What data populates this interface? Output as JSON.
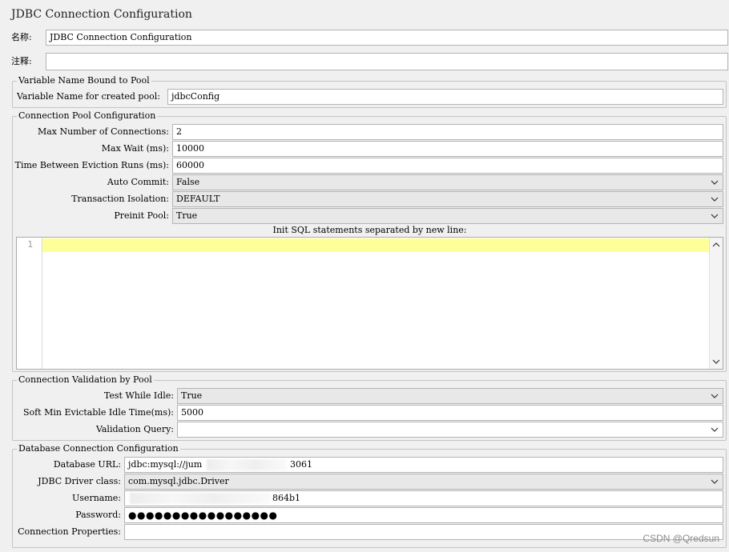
{
  "window": {
    "title": "JDBC Connection Configuration"
  },
  "name_row": {
    "label": "名称:",
    "value": "JDBC Connection Configuration"
  },
  "comment_row": {
    "label": "注释:",
    "value": ""
  },
  "variable_group": {
    "title": "Variable Name Bound to Pool",
    "var_label": "Variable Name for created pool:",
    "var_value": "jdbcConfig"
  },
  "pool_group": {
    "title": "Connection Pool Configuration",
    "max_conn_label": "Max Number of Connections:",
    "max_conn_value": "2",
    "max_wait_label": "Max Wait (ms):",
    "max_wait_value": "10000",
    "eviction_label": "Time Between Eviction Runs (ms):",
    "eviction_value": "60000",
    "auto_commit_label": "Auto Commit:",
    "auto_commit_value": "False",
    "isolation_label": "Transaction Isolation:",
    "isolation_value": "DEFAULT",
    "preinit_label": "Preinit Pool:",
    "preinit_value": "True",
    "init_sql_label": "Init SQL statements separated by new line:",
    "init_sql_line_number": "1",
    "init_sql_value": ""
  },
  "validation_group": {
    "title": "Connection Validation by Pool",
    "test_idle_label": "Test While Idle:",
    "test_idle_value": "True",
    "soft_min_label": "Soft Min Evictable Idle Time(ms):",
    "soft_min_value": "5000",
    "validation_query_label": "Validation Query:",
    "validation_query_value": ""
  },
  "db_group": {
    "title": "Database Connection Configuration",
    "url_label": "Database URL:",
    "url_prefix": "jdbc:mysql://jum",
    "url_suffix": "3061",
    "driver_label": "JDBC Driver class:",
    "driver_value": "com.mysql.jdbc.Driver",
    "username_label": "Username:",
    "username_suffix": "864b1",
    "password_label": "Password:",
    "password_mask": "●●●●●●●●●●●●●●●●●",
    "props_label": "Connection Properties:",
    "props_value": ""
  },
  "watermark": "CSDN @Qredsun"
}
